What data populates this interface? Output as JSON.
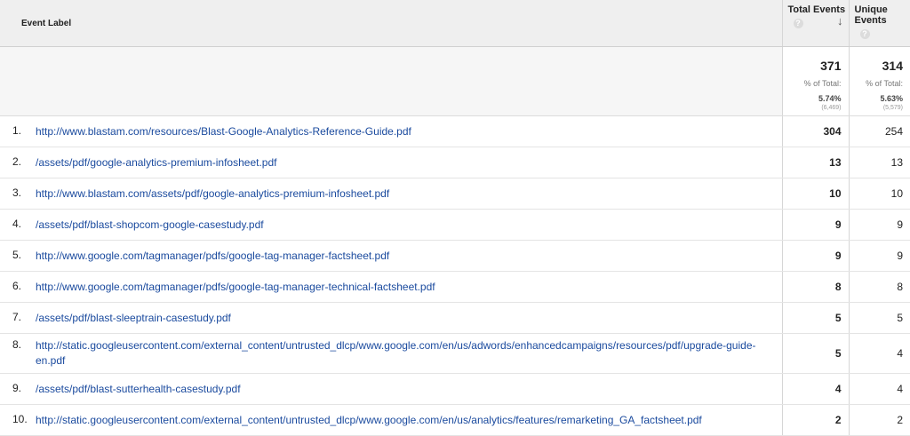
{
  "header": {
    "event_label": "Event Label",
    "total_events": "Total Events",
    "unique_events": "Unique Events",
    "help_glyph": "?",
    "sort_glyph": "↓"
  },
  "summary": {
    "total": {
      "value": "371",
      "pct_label": "% of Total:",
      "pct": "5.74%",
      "abs": "(6,469)"
    },
    "unique": {
      "value": "314",
      "pct_label": "% of Total:",
      "pct": "5.63%",
      "abs": "(5,579)"
    }
  },
  "rows": [
    {
      "idx": "1.",
      "label": "http://www.blastam.com/resources/Blast-Google-Analytics-Reference-Guide.pdf",
      "total": "304",
      "unique": "254"
    },
    {
      "idx": "2.",
      "label": "/assets/pdf/google-analytics-premium-infosheet.pdf",
      "total": "13",
      "unique": "13"
    },
    {
      "idx": "3.",
      "label": "http://www.blastam.com/assets/pdf/google-analytics-premium-infosheet.pdf",
      "total": "10",
      "unique": "10"
    },
    {
      "idx": "4.",
      "label": "/assets/pdf/blast-shopcom-google-casestudy.pdf",
      "total": "9",
      "unique": "9"
    },
    {
      "idx": "5.",
      "label": "http://www.google.com/tagmanager/pdfs/google-tag-manager-factsheet.pdf",
      "total": "9",
      "unique": "9"
    },
    {
      "idx": "6.",
      "label": "http://www.google.com/tagmanager/pdfs/google-tag-manager-technical-factsheet.pdf",
      "total": "8",
      "unique": "8"
    },
    {
      "idx": "7.",
      "label": "/assets/pdf/blast-sleeptrain-casestudy.pdf",
      "total": "5",
      "unique": "5"
    },
    {
      "idx": "8.",
      "label": "http://static.googleusercontent.com/external_content/untrusted_dlcp/www.google.com/en/us/adwords/enhancedcampaigns/resources/pdf/upgrade-guide-en.pdf",
      "total": "5",
      "unique": "4"
    },
    {
      "idx": "9.",
      "label": "/assets/pdf/blast-sutterhealth-casestudy.pdf",
      "total": "4",
      "unique": "4"
    },
    {
      "idx": "10.",
      "label": "http://static.googleusercontent.com/external_content/untrusted_dlcp/www.google.com/en/us/analytics/features/remarketing_GA_factsheet.pdf",
      "total": "2",
      "unique": "2"
    }
  ]
}
